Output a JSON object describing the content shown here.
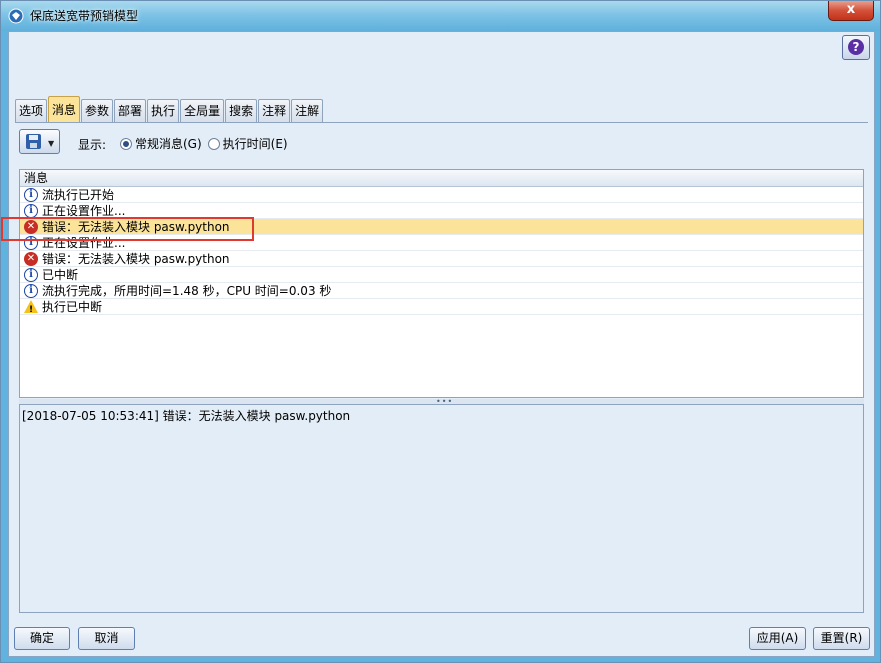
{
  "window": {
    "title": "保底送宽带预销模型",
    "close_label": "x",
    "help_label": "?"
  },
  "tabs": [
    {
      "label": "选项"
    },
    {
      "label": "消息"
    },
    {
      "label": "参数"
    },
    {
      "label": "部署"
    },
    {
      "label": "执行"
    },
    {
      "label": "全局量"
    },
    {
      "label": "搜索"
    },
    {
      "label": "注释"
    },
    {
      "label": "注解"
    }
  ],
  "toolbar": {
    "display_label": "显示:",
    "radio_general": "常规消息(G)",
    "radio_exec_time": "执行时间(E)"
  },
  "messages": {
    "header": "消息",
    "rows": [
      {
        "icon": "info-icon",
        "text": "流执行已开始"
      },
      {
        "icon": "info-icon",
        "text": "正在设置作业..."
      },
      {
        "icon": "error-icon",
        "text": "错误：无法装入模块 pasw.python"
      },
      {
        "icon": "info-icon",
        "text": "正在设置作业..."
      },
      {
        "icon": "error-icon",
        "text": "错误：无法装入模块 pasw.python"
      },
      {
        "icon": "info-icon",
        "text": "已中断"
      },
      {
        "icon": "info-icon",
        "text": "流执行完成，所用时间=1.48 秒，CPU 时间=0.03 秒"
      },
      {
        "icon": "warning-icon",
        "text": "执行已中断"
      }
    ]
  },
  "detail": {
    "text": "[2018-07-05 10:53:41] 错误：无法装入模块 pasw.python"
  },
  "buttons": {
    "ok": "确定",
    "cancel": "取消",
    "apply": "应用(A)",
    "reset": "重置(R)"
  },
  "colors": {
    "selected_row": "#fbe39a",
    "highlight_box": "#e03a30",
    "error": "#c62d24",
    "info": "#1b46a6",
    "warning": "#f3c21d"
  }
}
